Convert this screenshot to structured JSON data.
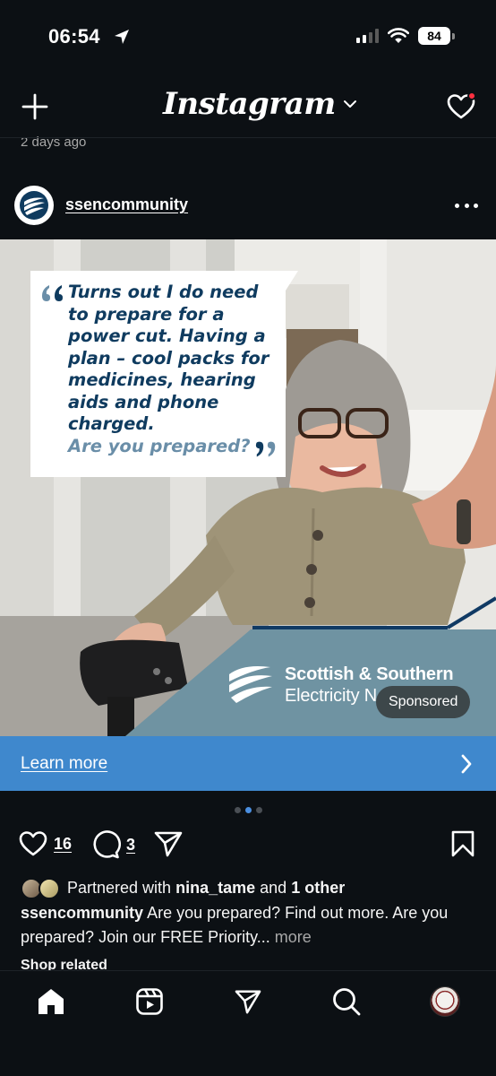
{
  "status_bar": {
    "time": "06:54",
    "battery": "84",
    "icons": [
      "location-arrow-icon",
      "signal-icon",
      "wifi-icon",
      "battery-icon"
    ]
  },
  "header": {
    "logo": "Instagram",
    "icons": [
      "plus-icon",
      "chevron-down-icon",
      "heart-icon"
    ]
  },
  "previous_post": {
    "time": "2 days ago"
  },
  "post": {
    "username": "ssencommunity",
    "quote": "Turns out I do need to prepare for a power cut. Having a plan – cool packs for medicines, hearing aids and phone charged.",
    "question": "Are you prepared?",
    "brand_line1": "Scottish & Southern",
    "brand_line2": "Electricity N",
    "sponsored": "Sponsored",
    "cta": "Learn more",
    "carousel": {
      "count": 3,
      "active_index": 1
    },
    "likes": "16",
    "comments": "3",
    "partner_text_1": "Partnered with",
    "partner_name": "nina_tame",
    "partner_text_2": "and",
    "partner_other": "1 other",
    "caption_user": "ssencommunity",
    "caption_text": "Are you prepared? Find out more. Are you prepared? Join our FREE Priority...",
    "caption_more": "more",
    "shop_related": "Shop related"
  },
  "tabbar": {
    "icons": [
      "home-icon",
      "reels-icon",
      "send-icon",
      "search-icon",
      "profile-avatar"
    ]
  },
  "colors": {
    "background": "#0c1014",
    "cta_blue": "#3f88cd",
    "quote_navy": "#0f3b5f",
    "brand_teal": "#6f93a2",
    "notification_red": "#ff3040"
  }
}
